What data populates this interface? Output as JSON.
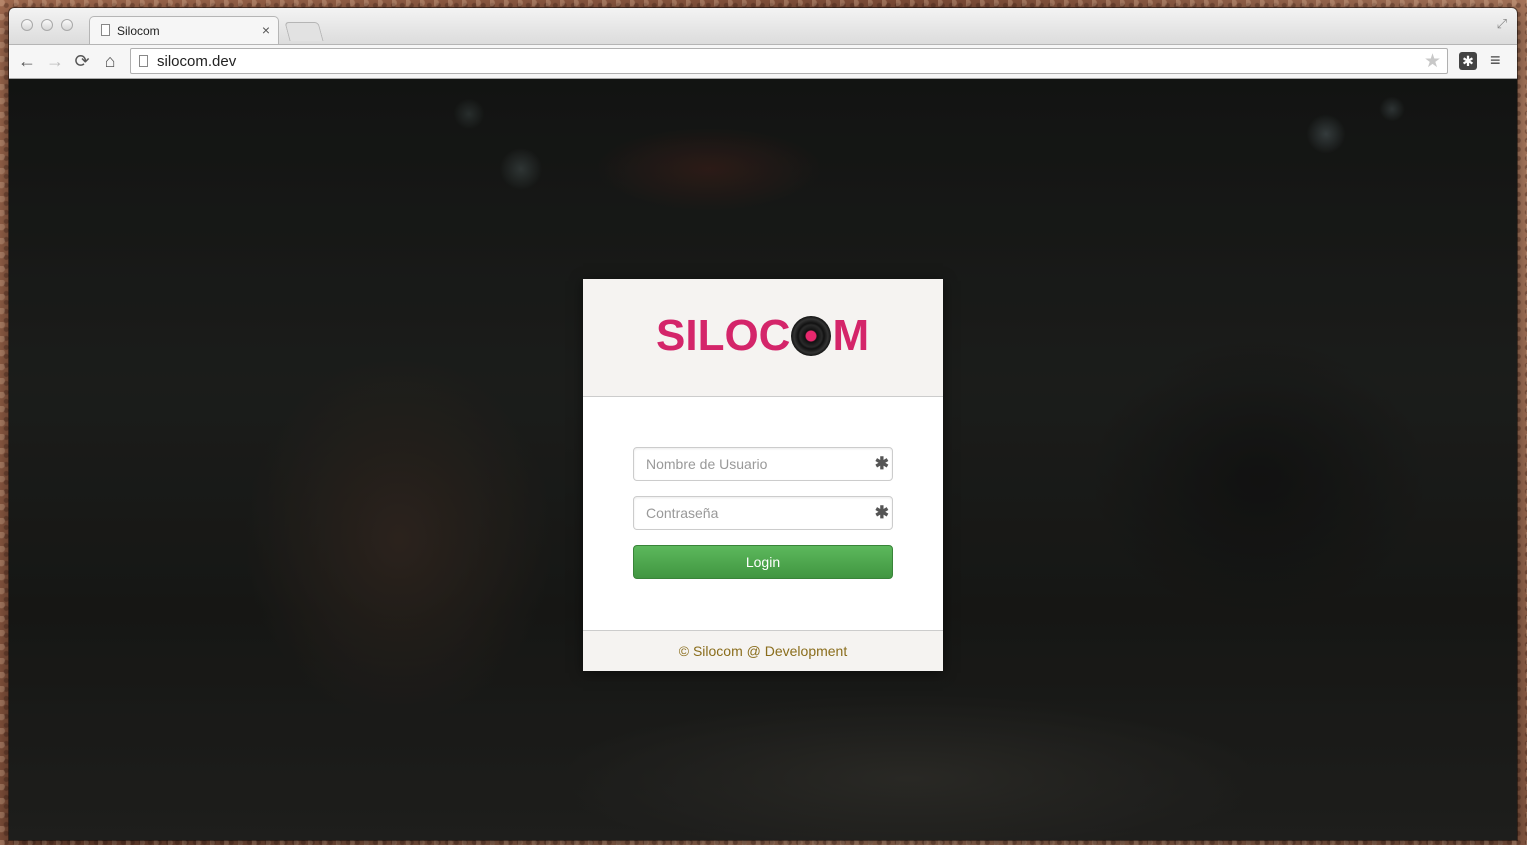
{
  "browser": {
    "tab_title": "Silocom",
    "tab_close": "×",
    "url": "silocom.dev",
    "nav": {
      "back": "←",
      "forward": "→",
      "reload": "⟳",
      "home": "⌂"
    },
    "bookmark_star": "★",
    "extension_glyph": "✱",
    "menu_glyph": "≡",
    "fullscreen_glyph": "⤢"
  },
  "login": {
    "logo_text_left": "SILOC",
    "logo_text_right": "M",
    "username_placeholder": "Nombre de Usuario",
    "password_placeholder": "Contraseña",
    "required_glyph": "✱",
    "login_button": "Login",
    "footer": "© Silocom @ Development"
  },
  "colors": {
    "brand": "#d4256a",
    "button_green": "#5cb85c",
    "footer_text": "#8a6d1c"
  }
}
